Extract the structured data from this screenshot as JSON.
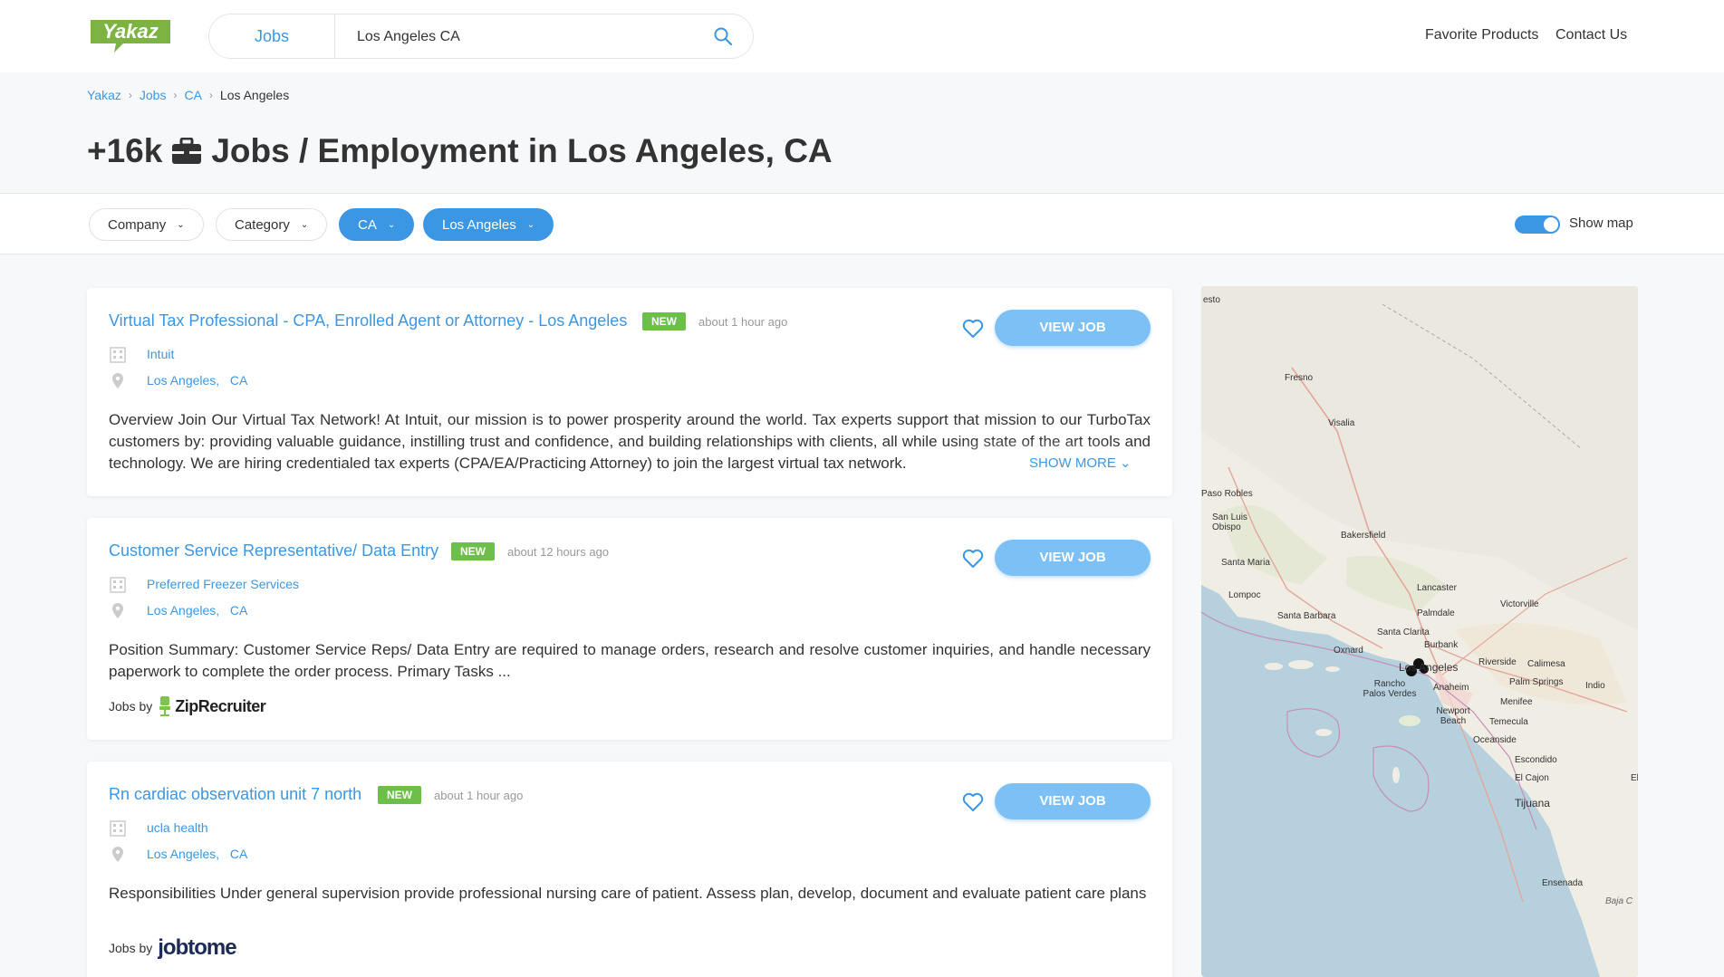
{
  "header": {
    "logo_text": "Yakaz",
    "search_tab": "Jobs",
    "search_value": "Los Angeles CA",
    "links": [
      "Favorite Products",
      "Contact Us"
    ]
  },
  "breadcrumb": [
    "Yakaz",
    "Jobs",
    "CA",
    "Los Angeles"
  ],
  "page_title": {
    "count": "+16k",
    "text": "Jobs / Employment in Los Angeles, CA"
  },
  "filters": {
    "company": "Company",
    "category": "Category",
    "state": "CA",
    "city": "Los Angeles",
    "show_map": "Show map",
    "show_map_on": true
  },
  "jobs": [
    {
      "title": "Virtual Tax Professional - CPA, Enrolled Agent or Attorney - Los Angeles",
      "badge": "NEW",
      "posted": "about 1 hour ago",
      "company": "Intuit",
      "city": "Los Angeles,",
      "state": "CA",
      "description": "Overview Join Our Virtual Tax Network! At Intuit, our mission is to power prosperity around the world. Tax experts support that mission to our TurboTax customers by: providing valuable guidance, instilling trust and confidence, and building relationships with clients, all while using state of the art tools and technology. We are hiring credentialed tax experts (CPA/EA/Practicing Attorney) to join the largest virtual tax network.",
      "show_more": "SHOW MORE",
      "button": "VIEW JOB"
    },
    {
      "title": "Customer Service Representative/ Data Entry",
      "badge": "NEW",
      "posted": "about 12 hours ago",
      "company": "Preferred Freezer Services",
      "city": "Los Angeles,",
      "state": "CA",
      "description": "Position Summary: Customer Service Reps/ Data Entry are required to manage orders, research and resolve customer inquiries, and handle necessary paperwork to complete the order process. Primary Tasks ...",
      "jobs_by": "Jobs by",
      "source": "ZipRecruiter",
      "button": "VIEW JOB"
    },
    {
      "title": "Rn cardiac observation unit 7 north",
      "badge": "NEW",
      "posted": "about 1 hour ago",
      "company": "ucla health",
      "city": "Los Angeles,",
      "state": "CA",
      "description": "Responsibilities Under general supervision provide professional nursing care of patient. Assess plan, develop, document and evaluate patient care plans",
      "jobs_by": "Jobs by",
      "source": "jobtome",
      "button": "VIEW JOB"
    }
  ],
  "map": {
    "labels": [
      "esto",
      "Fresno",
      "Visalia",
      "Paso Robles",
      "San Luis Obispo",
      "Bakersfield",
      "Santa Maria",
      "Lompoc",
      "Lancaster",
      "Palmdale",
      "Victorville",
      "Santa Barbara",
      "Santa Clarita",
      "Oxnard",
      "Burbank",
      "Los Angeles",
      "Riverside",
      "Calimesa",
      "Rancho Palos Verdes",
      "Anaheim",
      "Palm Springs",
      "Indio",
      "Menifee",
      "Newport Beach",
      "Temecula",
      "Oceanside",
      "Escondido",
      "El Cajon",
      "El",
      "Tijuana",
      "Ensenada",
      "Baja C"
    ]
  },
  "colors": {
    "accent": "#3b97e3",
    "new_badge": "#6cc04a",
    "view_button": "#7cc0f5",
    "logo_green": "#7cb342"
  }
}
